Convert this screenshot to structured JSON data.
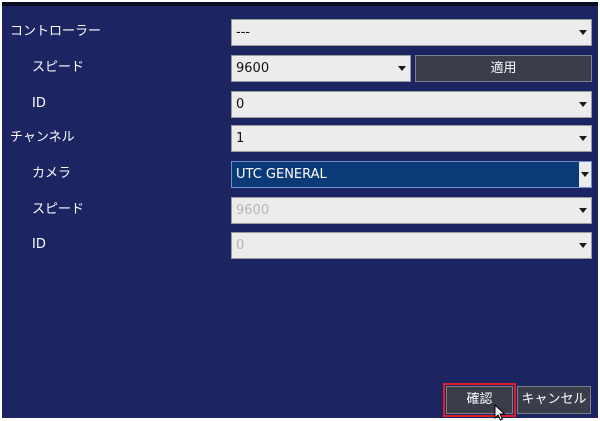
{
  "form": {
    "controller": {
      "label": "コントローラー",
      "value": "---"
    },
    "controller_speed": {
      "label": "スピード",
      "value": "9600"
    },
    "apply_button": "適用",
    "controller_id": {
      "label": "ID",
      "value": "0"
    },
    "channel": {
      "label": "チャンネル",
      "value": "1"
    },
    "camera": {
      "label": "カメラ",
      "value": "UTC GENERAL"
    },
    "camera_speed": {
      "label": "スピード",
      "value": "9600"
    },
    "camera_id": {
      "label": "ID",
      "value": "0"
    }
  },
  "footer": {
    "confirm_label": "確認",
    "cancel_label": "キャンセル"
  },
  "colors": {
    "panel_background": "#1c2461",
    "selected_field": "#0b3a78",
    "focus_highlight": "#e02020"
  },
  "icons": {
    "dropdown": "chevron-down-icon",
    "cursor": "mouse-pointer-icon"
  }
}
